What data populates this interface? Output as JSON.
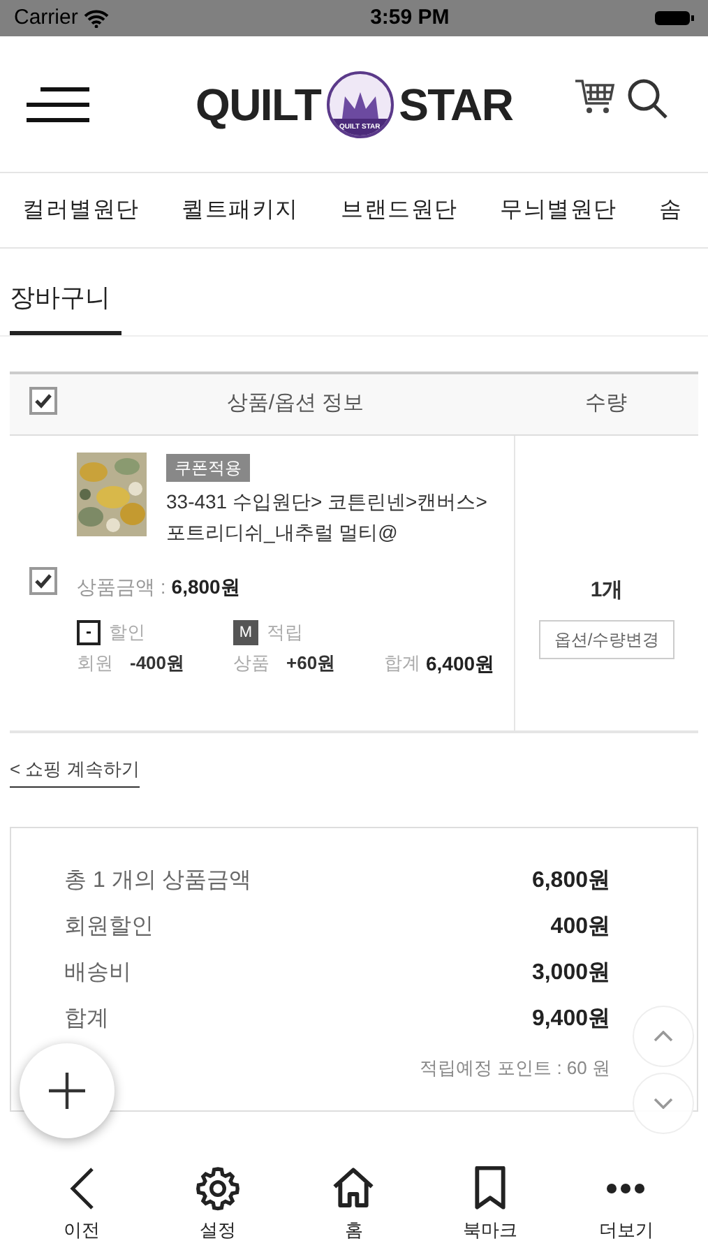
{
  "status_bar": {
    "carrier": "Carrier",
    "time": "3:59 PM"
  },
  "header": {
    "logo_left": "QUILT",
    "logo_badge": "QUILT STAR",
    "logo_right": "STAR"
  },
  "categories": [
    {
      "label": "컬러별원단"
    },
    {
      "label": "퀼트패키지"
    },
    {
      "label": "브랜드원단"
    },
    {
      "label": "무늬별원단"
    },
    {
      "label": "솜"
    }
  ],
  "page_title": "장바구니",
  "cart_table": {
    "select_all": {
      "checked": true
    },
    "columns": [
      "상품/옵션 정보",
      "수량"
    ],
    "items": [
      {
        "checked": true,
        "badge": "쿠폰적용",
        "name": "33-431 수입원단> 코튼린넨>캔버스>포트리디쉬_내추럴 멀티@",
        "price_label": "상품금액 :",
        "price": "6,800원",
        "discount_icon": "-",
        "discount_title": "할인",
        "discount_label": "회원",
        "discount_value": "-400원",
        "points_icon": "M",
        "points_title": "적립",
        "points_label": "상품",
        "points_value": "+60원",
        "total_label": "합계",
        "total_value": "6,400원",
        "quantity": "1개",
        "change_button": "옵션/수량변경"
      }
    ]
  },
  "continue_shopping": "< 쇼핑 계속하기",
  "summary": {
    "rows": [
      {
        "label": "총 1 개의 상품금액",
        "value": "6,800원"
      },
      {
        "label": "회원할인",
        "value": "400원"
      },
      {
        "label": "배송비",
        "value": "3,000원"
      },
      {
        "label": "합계",
        "value": "9,400원"
      }
    ],
    "points": "적립예정 포인트 : 60 원"
  },
  "bottom_nav": [
    {
      "label": "이전",
      "kind": "back"
    },
    {
      "label": "설정",
      "kind": "settings"
    },
    {
      "label": "홈",
      "kind": "home"
    },
    {
      "label": "북마크",
      "kind": "bookmark"
    },
    {
      "label": "더보기",
      "kind": "more"
    }
  ]
}
